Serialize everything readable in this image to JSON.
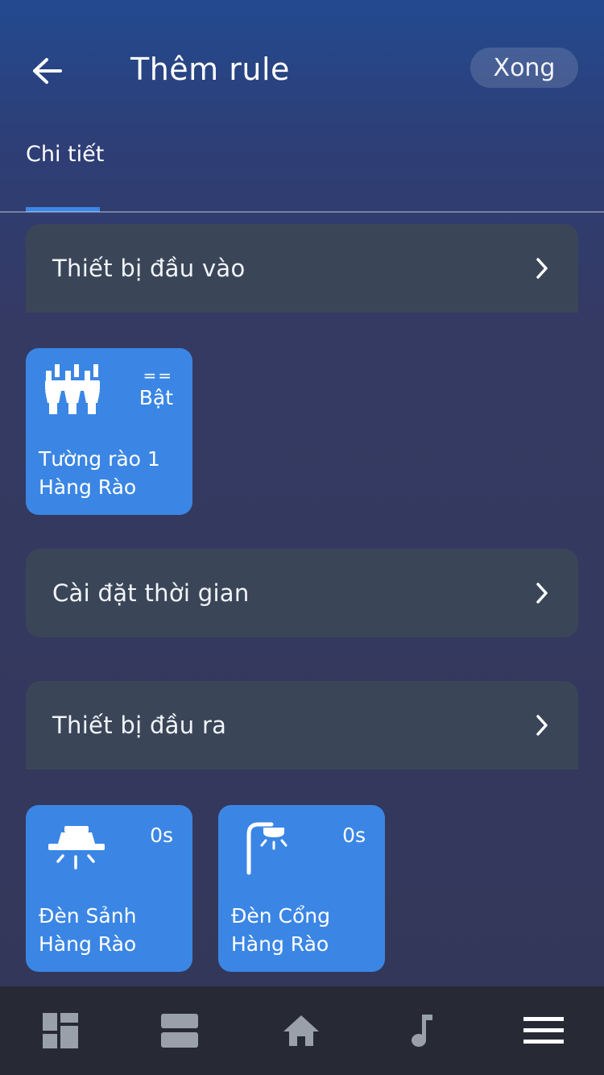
{
  "header": {
    "title": "Thêm rule",
    "done_label": "Xong",
    "back_icon": "arrow-left-icon"
  },
  "tabs": [
    {
      "label": "Chi tiết",
      "active": true
    }
  ],
  "sections": {
    "input": {
      "label": "Thiết bị đầu vào"
    },
    "time": {
      "label": "Cài đặt thời gian"
    },
    "output": {
      "label": "Thiết bị đầu ra"
    }
  },
  "input_devices": [
    {
      "icon": "fence-icon",
      "operator": "==",
      "state": "Bật",
      "name": "Tường rào 1",
      "group": "Hàng Rào"
    }
  ],
  "output_devices": [
    {
      "icon": "ceiling-lamp-icon",
      "delay": "0s",
      "name": "Đèn Sảnh",
      "group": "Hàng Rào"
    },
    {
      "icon": "street-lamp-icon",
      "delay": "0s",
      "name": "Đèn Cổng",
      "group": "Hàng Rào"
    }
  ],
  "bottom_nav": [
    {
      "icon": "dashboard-icon",
      "active": false
    },
    {
      "icon": "rooms-icon",
      "active": false
    },
    {
      "icon": "home-icon",
      "active": false
    },
    {
      "icon": "music-icon",
      "active": false
    },
    {
      "icon": "menu-icon",
      "active": true
    }
  ],
  "colors": {
    "accent": "#3b86e4",
    "row_bg": "#3a4658",
    "nav_bg": "#272a34",
    "nav_icon": "#9aa0aa",
    "nav_icon_active": "#ffffff"
  }
}
